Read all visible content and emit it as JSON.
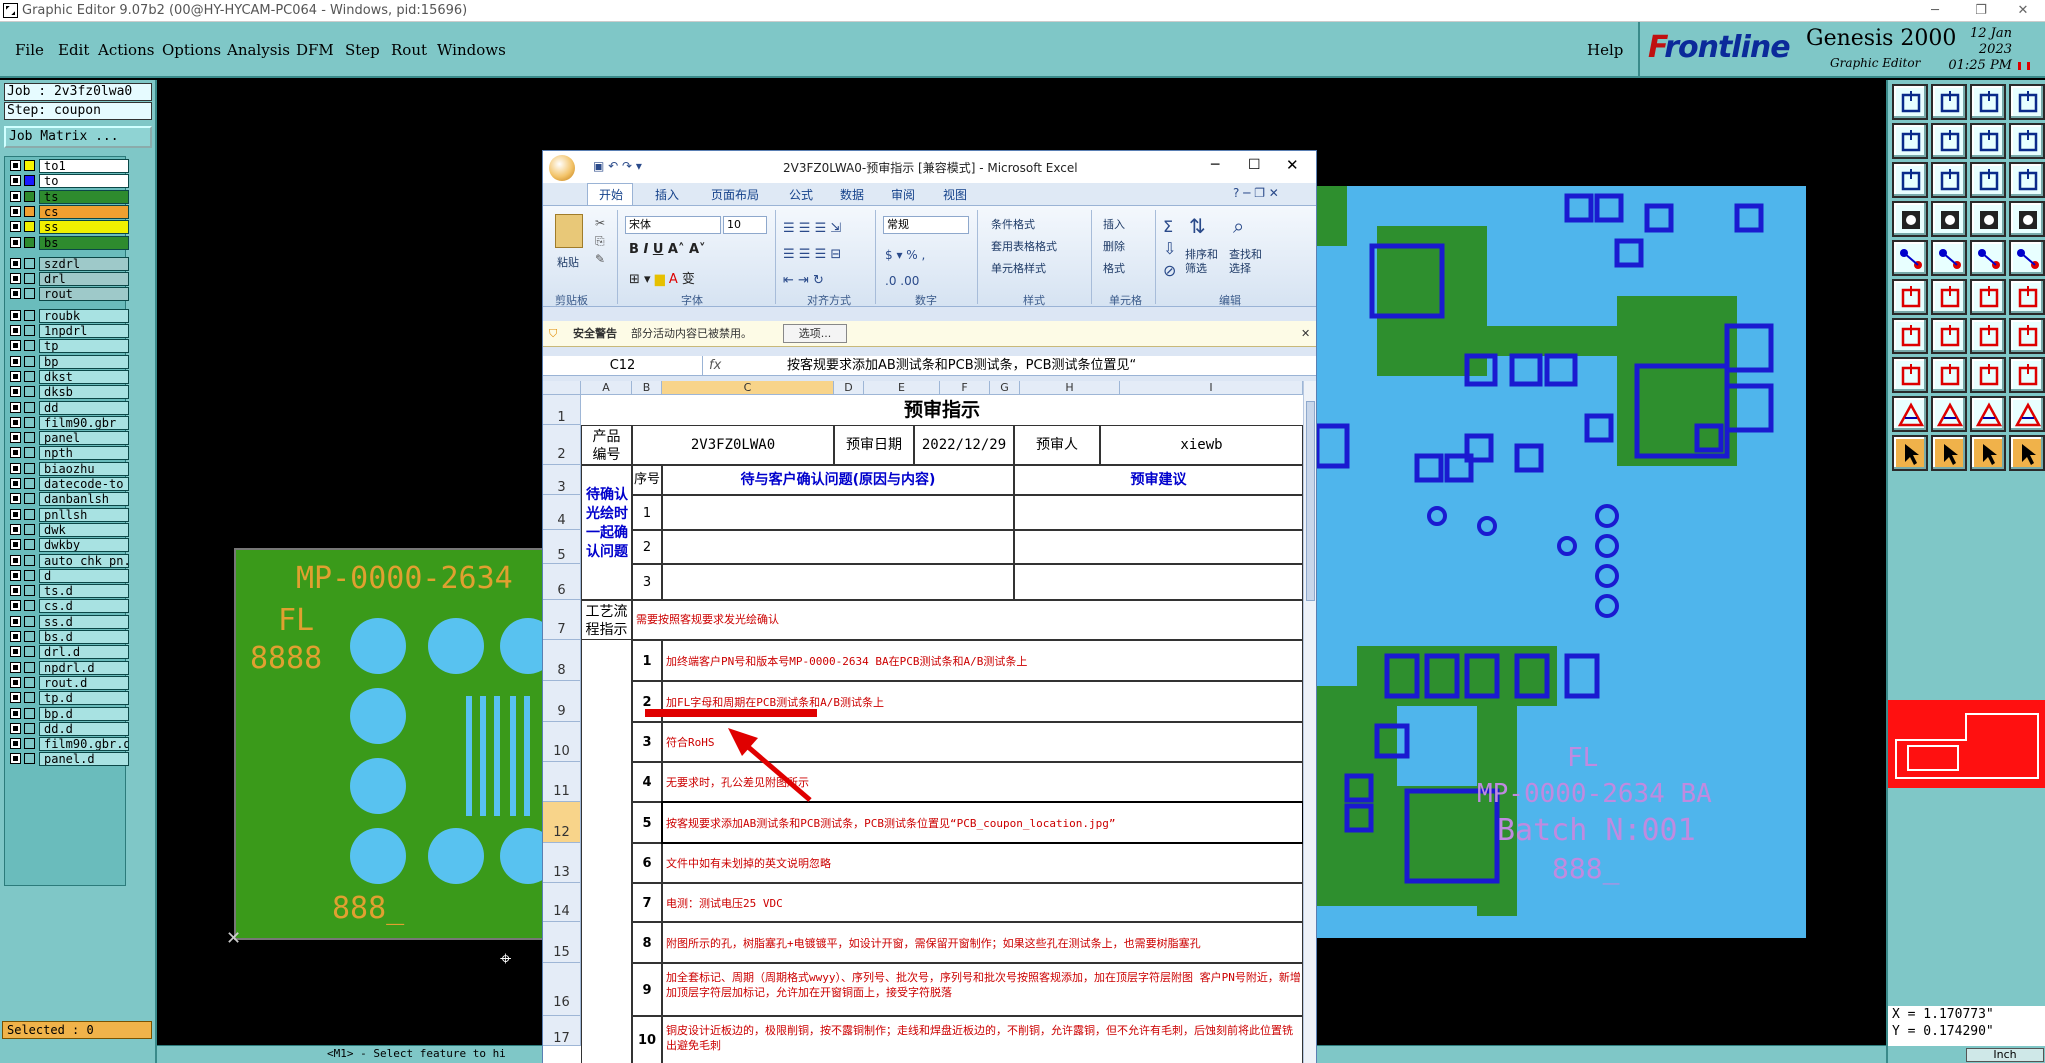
{
  "window": {
    "title": "Graphic Editor 9.07b2 (00@HY-HYCAM-PC064 - Windows, pid:15696)"
  },
  "menu": [
    "File",
    "Edit",
    "Actions",
    "Options",
    "Analysis",
    "DFM",
    "Step",
    "Rout",
    "Windows"
  ],
  "help": "Help",
  "brand": {
    "logo": "Frontline",
    "product": "Genesis 2000",
    "subtitle": "Graphic Editor",
    "date": "12 Jan 2023",
    "time": "01:25 PM"
  },
  "job": {
    "job": "Job  : 2v3fz0lwa0",
    "step": "Step: coupon",
    "matrix": "Job Matrix ..."
  },
  "layers": [
    {
      "name": "to1",
      "color": "#f7f700"
    },
    {
      "name": "to",
      "color": "#1a1aff"
    },
    {
      "name": "ts",
      "color": "#2e8b2e"
    },
    {
      "name": "cs",
      "color": "#f0a030"
    },
    {
      "name": "ss",
      "color": "#f0f000"
    },
    {
      "name": "bs",
      "color": "#2e8b2e"
    },
    {
      "name": "szdrl",
      "color": ""
    },
    {
      "name": "drl",
      "color": ""
    },
    {
      "name": "rout",
      "color": ""
    },
    {
      "name": "roubk",
      "color": ""
    },
    {
      "name": "1npdrl",
      "color": ""
    },
    {
      "name": "tp",
      "color": ""
    },
    {
      "name": "bp",
      "color": ""
    },
    {
      "name": "dkst",
      "color": ""
    },
    {
      "name": "dksb",
      "color": ""
    },
    {
      "name": "dd",
      "color": ""
    },
    {
      "name": "film90.gbr",
      "color": ""
    },
    {
      "name": "panel",
      "color": ""
    },
    {
      "name": "npth",
      "color": ""
    },
    {
      "name": "biaozhu",
      "color": ""
    },
    {
      "name": "datecode-to",
      "color": ""
    },
    {
      "name": "danbanlsh",
      "color": ""
    },
    {
      "name": "pnllsh",
      "color": ""
    },
    {
      "name": "dwk",
      "color": ""
    },
    {
      "name": "dwkby",
      "color": ""
    },
    {
      "name": "auto_chk_pn.",
      "color": ""
    },
    {
      "name": "d",
      "color": ""
    },
    {
      "name": "ts.d",
      "color": ""
    },
    {
      "name": "cs.d",
      "color": ""
    },
    {
      "name": "ss.d",
      "color": ""
    },
    {
      "name": "bs.d",
      "color": ""
    },
    {
      "name": "drl.d",
      "color": ""
    },
    {
      "name": "npdrl.d",
      "color": ""
    },
    {
      "name": "rout.d",
      "color": ""
    },
    {
      "name": "tp.d",
      "color": ""
    },
    {
      "name": "bp.d",
      "color": ""
    },
    {
      "name": "dd.d",
      "color": ""
    },
    {
      "name": "film90.gbr.d",
      "color": ""
    },
    {
      "name": "panel.d",
      "color": ""
    }
  ],
  "selected": "Selected : 0",
  "status": "<M1> - Select feature to hi",
  "coords": {
    "x": "X = 1.170773\"",
    "y": "Y = 0.174290\""
  },
  "units": "Inch",
  "pcb_left": {
    "part": "MP-0000-2634",
    "fl": "FL",
    "code": "8888",
    "date": "888_"
  },
  "pcb_right": {
    "fl": "FL",
    "part": "MP-0000-2634 BA",
    "batch": "Batch N:001",
    "date": "888_"
  },
  "excel": {
    "title": "2V3FZ0LWA0-预审指示 [兼容模式] - Microsoft Excel",
    "tabs": [
      "开始",
      "插入",
      "页面布局",
      "公式",
      "数据",
      "审阅",
      "视图"
    ],
    "ribbon": {
      "font": "宋体",
      "size": "10",
      "format": "常规",
      "paste": "粘贴",
      "groups": [
        "剪贴板",
        "字体",
        "对齐方式",
        "数字",
        "样式",
        "单元格",
        "编辑"
      ],
      "styles": [
        "条件格式",
        "套用表格格式",
        "单元格样式"
      ],
      "cells": [
        "插入",
        "删除",
        "格式"
      ],
      "edit": [
        "排序和筛选",
        "查找和选择"
      ]
    },
    "warning": {
      "label": "安全警告",
      "text": "部分活动内容已被禁用。",
      "button": "选项..."
    },
    "namebox": "C12",
    "fx": "fx",
    "formula": "按客规要求添加AB测试条和PCB测试条，PCB测试条位置见“",
    "columns": [
      "A",
      "B",
      "C",
      "D",
      "E",
      "F",
      "G",
      "H",
      "I"
    ],
    "rows": [
      "1",
      "2",
      "3",
      "4",
      "5",
      "6",
      "7",
      "8",
      "9",
      "10",
      "11",
      "12",
      "13",
      "14",
      "15",
      "16",
      "17"
    ],
    "sheet_title": "预审指示",
    "product_label": "产品编号",
    "product_no": "2V3FZ0LWA0",
    "date_label": "预审日期",
    "date": "2022/12/29",
    "reviewer_label": "预审人",
    "reviewer": "xiewb",
    "confirm_label": "待确认光绘时一起确认问题",
    "seq_label": "序号",
    "issue_header": "待与客户确认问题(原因与内容)",
    "advice_header": "预审建议",
    "confirm_nums": [
      "1",
      "2",
      "3"
    ],
    "process_label": "工艺流程指示",
    "process_intro": "需要按照客规要求发光绘确认",
    "items": [
      {
        "n": "1",
        "text": "加终端客户PN号和版本号MP-0000-2634 BA在PCB测试条和A/B测试条上"
      },
      {
        "n": "2",
        "text": "加FL字母和周期在PCB测试条和A/B测试条上"
      },
      {
        "n": "3",
        "text": "符合RoHS"
      },
      {
        "n": "4",
        "text": "无要求时，孔公差见附图所示"
      },
      {
        "n": "5",
        "text": "按客规要求添加AB测试条和PCB测试条，PCB测试条位置见“PCB_coupon_location.jpg”"
      },
      {
        "n": "6",
        "text": "文件中如有未划掉的英文说明忽略"
      },
      {
        "n": "7",
        "text": "电测：测试电压25 VDC"
      },
      {
        "n": "8",
        "text": "附图所示的孔，树脂塞孔+电镀镀平，如设计开窗，需保留开窗制作；如果这些孔在测试条上，也需要树脂塞孔"
      },
      {
        "n": "9",
        "text": "加全套标记、周期（周期格式wwyy）、序列号、批次号，序列号和批次号按照客规添加，加在顶层字符层附图 客户PN号附近，新增加顶层字符层加标记，允许加在开窗铜面上，接受字符脱落"
      },
      {
        "n": "10",
        "text": "铜皮设计近板边的，极限削铜，按不露铜制作；走线和焊盘近板边的，不削铜，允许露铜，但不允许有毛刺，后蚀刻前将此位置铣出避免毛刺"
      }
    ]
  },
  "colors": {
    "teal": "#7fc7c7",
    "pcb_blue": "#4fb5ec",
    "pcb_green": "#3a9a1a",
    "trace_blue": "#1a1ad0",
    "excel_red": "#cc0000"
  }
}
